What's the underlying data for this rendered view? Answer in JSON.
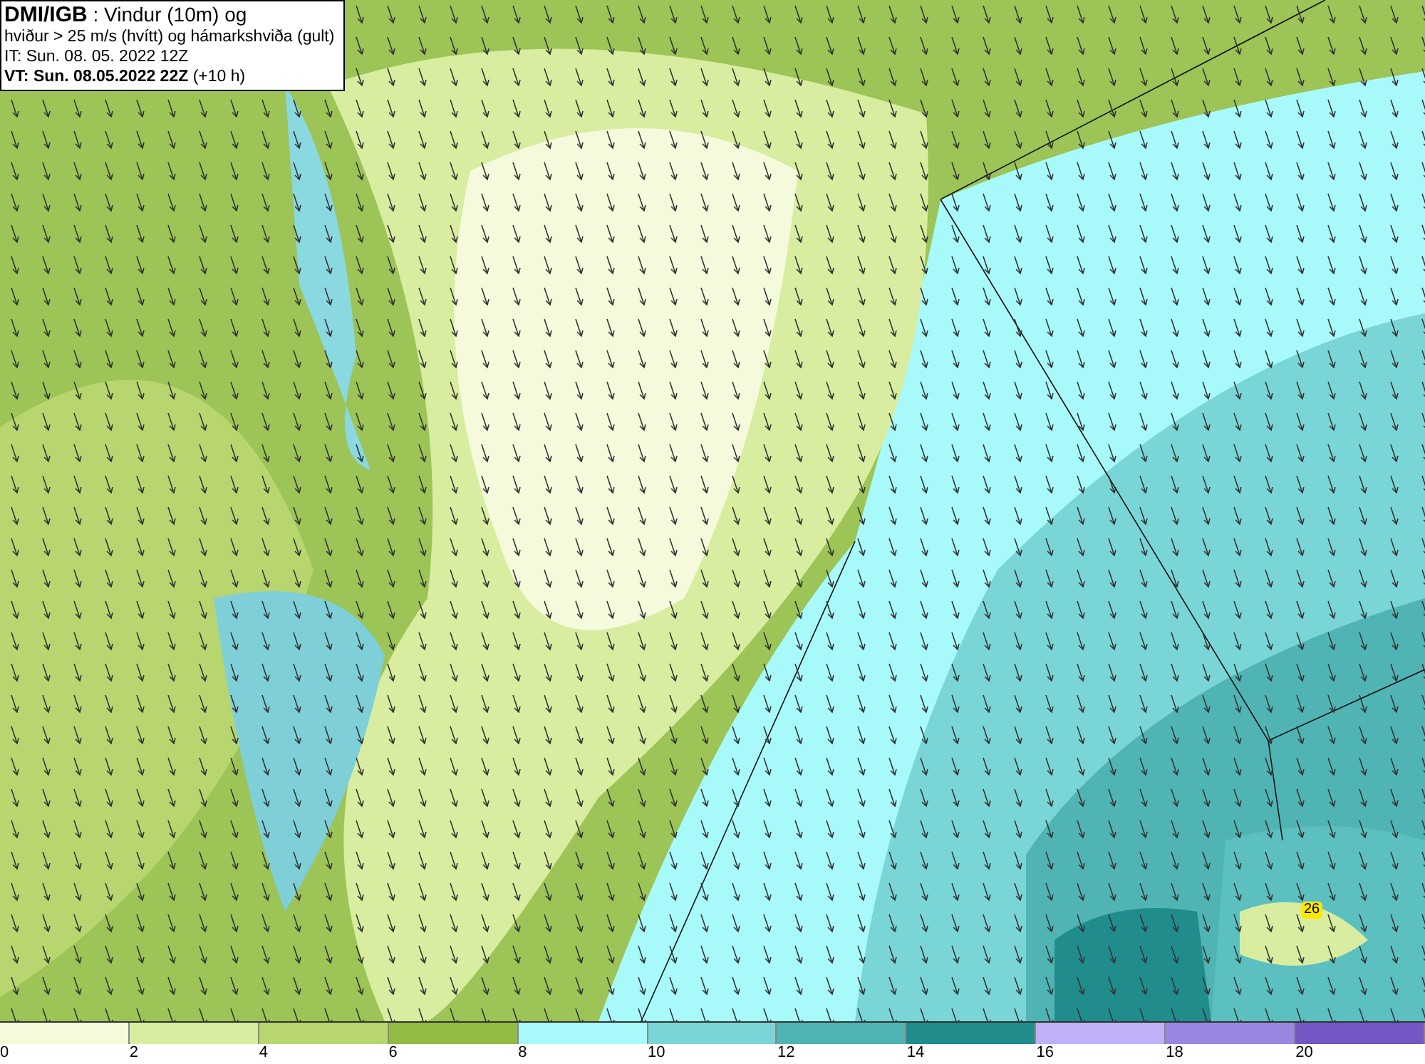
{
  "header": {
    "lines": [
      "**DMI/IGB** : Vindur (10m) og",
      "hviður > 25 m/s (hvítt) og hámarkshviða (gult)",
      "IT: Sun. 08. 05. 2022 12Z",
      "**VT: Sun. 08.05.2022 22Z** (+10 h)"
    ]
  },
  "map": {
    "gust_label": "26"
  },
  "legend": [
    {
      "label": "0",
      "color": "#f5fadc"
    },
    {
      "label": "2",
      "color": "#d8eda0"
    },
    {
      "label": "4",
      "color": "#b7d670"
    },
    {
      "label": "6",
      "color": "#93ba42"
    },
    {
      "label": "8",
      "color": "#a8fafa"
    },
    {
      "label": "10",
      "color": "#7ad6d6"
    },
    {
      "label": "12",
      "color": "#50b4b4"
    },
    {
      "label": "14",
      "color": "#208c8c"
    },
    {
      "label": "16",
      "color": "#c0b0f8"
    },
    {
      "label": "18",
      "color": "#9a86e0"
    },
    {
      "label": "20",
      "color": "#7456c4"
    }
  ]
}
